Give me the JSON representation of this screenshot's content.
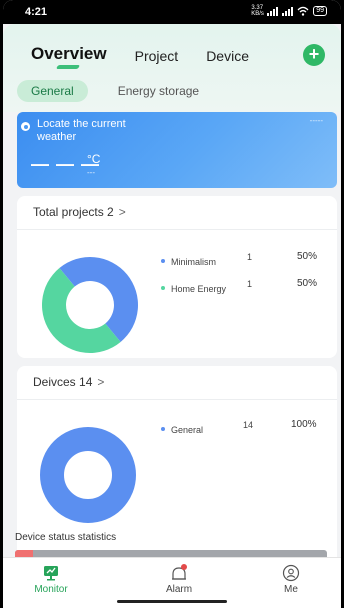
{
  "status_bar": {
    "time": "4:21",
    "speed": "3.37 KB/s",
    "battery": "99"
  },
  "header": {
    "tabs": [
      "Overview",
      "Project",
      "Device"
    ],
    "active_tab": "Overview",
    "sub_tabs": [
      "General",
      "Energy storage"
    ],
    "active_sub_tab": "General"
  },
  "weather": {
    "location_prompt": "Locate the current weather",
    "temperature": "— — —",
    "unit": "°C",
    "sub_value": "---",
    "right_value": "-----"
  },
  "projects_card": {
    "title": "Total projects 2",
    "chevron": ">",
    "legend": [
      {
        "name": "Minimalism",
        "count": "1",
        "percent": "50%",
        "color": "#5b8ff0"
      },
      {
        "name": "Home Energy",
        "count": "1",
        "percent": "50%",
        "color": "#55d6a0"
      }
    ]
  },
  "devices_card": {
    "title": "Deivces 14",
    "chevron": ">",
    "legend": [
      {
        "name": "General",
        "count": "14",
        "percent": "100%",
        "color": "#5b8ff0"
      }
    ],
    "status_title": "Device status statistics"
  },
  "chart_data": [
    {
      "type": "pie",
      "categories": [
        "Minimalism",
        "Home Energy"
      ],
      "values": [
        1,
        1
      ],
      "colors": [
        "#5b8ff0",
        "#55d6a0"
      ]
    },
    {
      "type": "pie",
      "categories": [
        "General"
      ],
      "values": [
        14
      ],
      "colors": [
        "#5b8ff0"
      ]
    }
  ],
  "tabbar": {
    "items": [
      {
        "label": "Monitor",
        "icon": "monitor-icon",
        "active": true
      },
      {
        "label": "Alarm",
        "icon": "bell-icon",
        "active": false
      },
      {
        "label": "Me",
        "icon": "user-icon",
        "active": false
      }
    ],
    "accent": "#27a45a",
    "alarm_badge_color": "#e34a4a"
  }
}
